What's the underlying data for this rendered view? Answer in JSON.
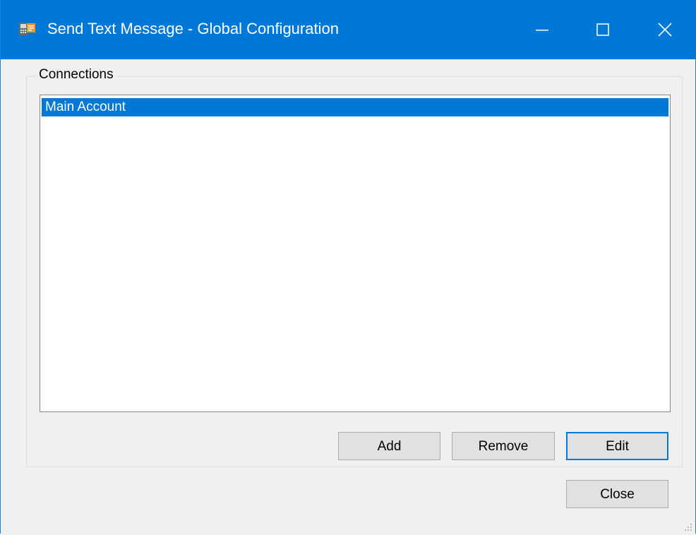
{
  "window": {
    "title": "Send Text Message - Global Configuration",
    "controls": {
      "minimize": "minimize-icon",
      "maximize": "maximize-icon",
      "close": "close-icon"
    },
    "accent_color": "#0078d7"
  },
  "connections": {
    "label": "Connections",
    "items": [
      {
        "label": "Main Account",
        "selected": true
      }
    ]
  },
  "buttons": {
    "add": "Add",
    "remove": "Remove",
    "edit": "Edit",
    "close": "Close"
  }
}
